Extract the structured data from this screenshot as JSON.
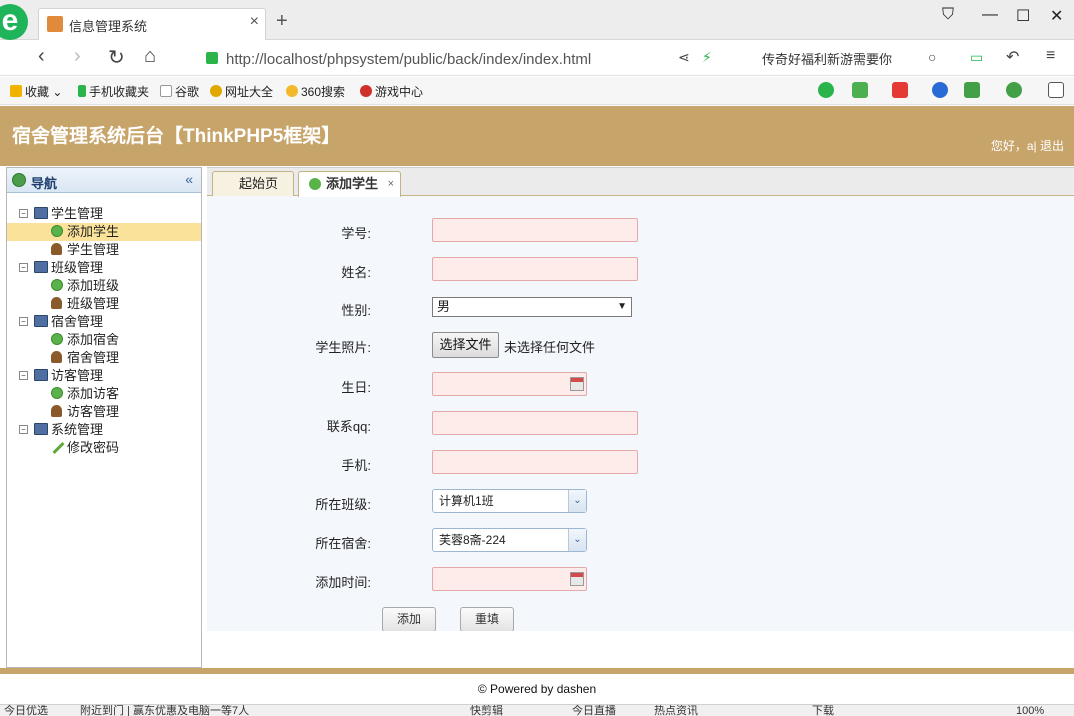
{
  "browser": {
    "tab_title": "信息管理系统",
    "url": "http://localhost/phpsystem/public/back/index/index.html",
    "search_text": "传奇好福利新游需要你",
    "bookmarks": [
      "收藏",
      "手机收藏夹",
      "谷歌",
      "网址大全",
      "360搜索",
      "游戏中心"
    ],
    "status_items": [
      "今日优选",
      "附近到门 | 赢东优惠及电脑一等7人",
      "快剪辑",
      "今日直播",
      "热点资讯",
      "下载",
      "100%"
    ]
  },
  "header": {
    "title": "宿舍管理系统后台【ThinkPHP5框架】",
    "greeting": "您好，a|",
    "logout": "退出"
  },
  "sidebar": {
    "title": "导航",
    "collapse": "«",
    "groups": [
      {
        "label": "学生管理",
        "items": [
          "添加学生",
          "学生管理"
        ]
      },
      {
        "label": "班级管理",
        "items": [
          "添加班级",
          "班级管理"
        ]
      },
      {
        "label": "宿舍管理",
        "items": [
          "添加宿舍",
          "宿舍管理"
        ]
      },
      {
        "label": "访客管理",
        "items": [
          "添加访客",
          "访客管理"
        ]
      },
      {
        "label": "系统管理",
        "items": [
          "修改密码"
        ]
      }
    ]
  },
  "tabs": {
    "home": "起始页",
    "add_student": "添加学生",
    "close": "×"
  },
  "form": {
    "student_no_label": "学号:",
    "name_label": "姓名:",
    "gender_label": "性别:",
    "gender_value": "男",
    "photo_label": "学生照片:",
    "file_button": "选择文件",
    "file_status": "未选择任何文件",
    "birthday_label": "生日:",
    "qq_label": "联系qq:",
    "phone_label": "手机:",
    "class_label": "所在班级:",
    "class_value": "计算机1班",
    "dorm_label": "所在宿舍:",
    "dorm_value": "芙蓉8斋-224",
    "add_time_label": "添加时间:",
    "submit": "添加",
    "reset": "重填"
  },
  "footer": {
    "text": "© Powered by dashen"
  },
  "colors": {
    "header_bg": "#c7a46a",
    "input_error_bg": "#fdecea",
    "selected_row": "#fbe29a"
  }
}
